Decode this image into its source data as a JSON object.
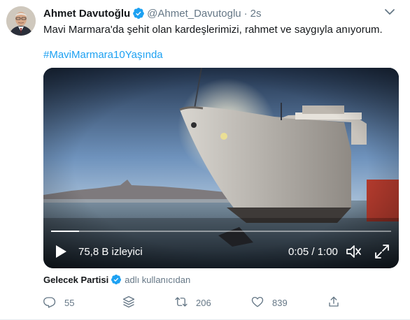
{
  "tweet": {
    "author_name": "Ahmet Davutoğlu",
    "author_handle": "@Ahmet_Davutoglu",
    "separator": "·",
    "time": "2s",
    "text": "Mavi Marmara'da şehit olan kardeşlerimizi, rahmet ve saygıyla anıyorum.",
    "hashtag": "#MaviMarmara10Yaşında"
  },
  "video": {
    "views": "75,8 B izleyici",
    "timecode": "0:05 / 1:00",
    "progress": 0.083
  },
  "attribution": {
    "name": "Gelecek Partisi",
    "suffix": "adlı kullanıcıdan"
  },
  "actions": {
    "reply_count": "55",
    "retweet_count": "206",
    "like_count": "839"
  },
  "colors": {
    "accent": "#1da1f2",
    "secondary_text": "#657786",
    "primary_text": "#14171a"
  },
  "icons": [
    "verified-badge-icon",
    "chevron-down-icon",
    "play-icon",
    "volume-icon",
    "fullscreen-icon",
    "reply-icon",
    "stack-icon",
    "retweet-icon",
    "like-icon",
    "share-icon"
  ]
}
